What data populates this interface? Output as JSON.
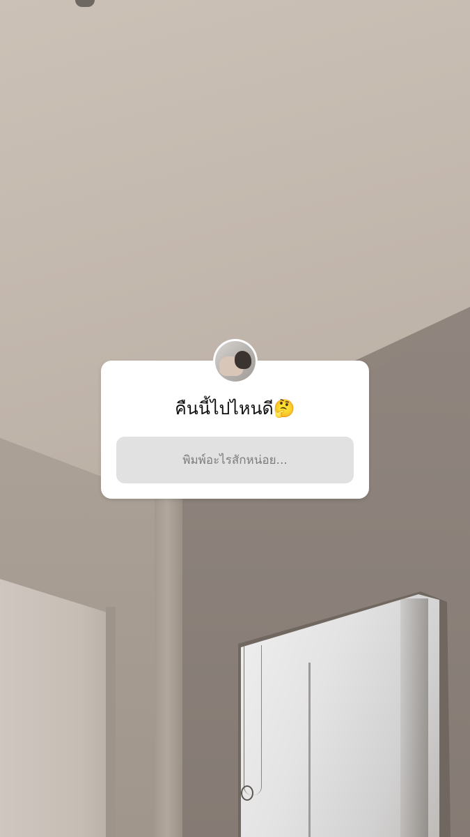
{
  "story": {
    "question_sticker": {
      "question_text": "คืนนี้ไปไหนดี",
      "question_emoji": "🤔",
      "emoji_name": "thinking-face-icon",
      "answer_placeholder": "พิมพ์อะไรสักหน่อย..."
    },
    "colors": {
      "sticker_background": "#ffffff",
      "answer_box_background": "#e1e1e1",
      "placeholder_text": "#7c7c7c",
      "question_text": "#111111"
    }
  }
}
